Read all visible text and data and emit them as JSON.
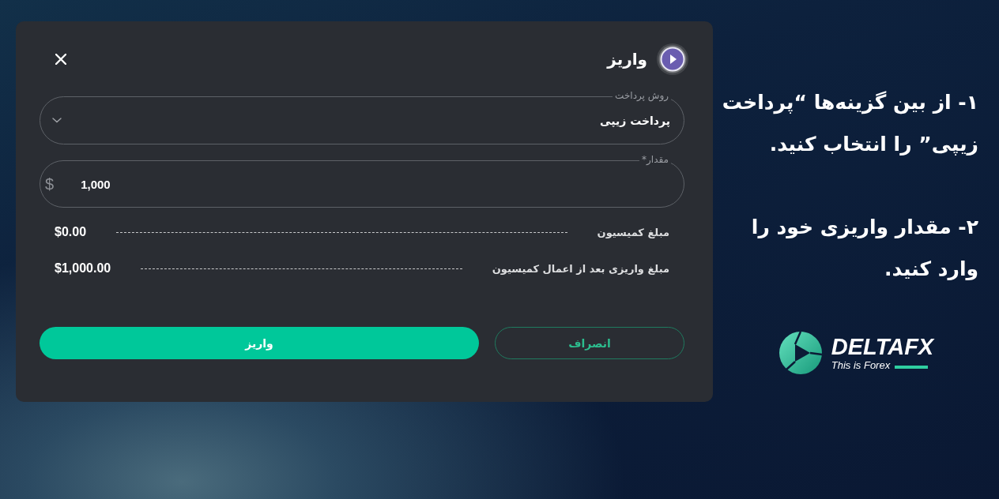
{
  "dialog": {
    "title": "واریز"
  },
  "fields": [
    {
      "kind": "select",
      "label": "روش پرداخت",
      "value": "پرداخت زیپی"
    },
    {
      "kind": "amount",
      "label": "مقدار*",
      "prefix": "$",
      "value": "1,000"
    }
  ],
  "summary": [
    {
      "label": "مبلغ کمیسیون",
      "value": "$0.00"
    },
    {
      "label": "مبلغ واریزی بعد از اعمال کمیسیون",
      "value": "$1,000.00"
    }
  ],
  "buttons": [
    {
      "kind": "secondary",
      "label": "انصراف"
    },
    {
      "kind": "primary",
      "label": "واریز"
    }
  ],
  "instructions": [
    "۱- از بین گزینه‌ها “پرداخت زیپی” را انتخاب کنید.",
    "۲- مقدار واریزی خود را وارد کنید."
  ],
  "logo": {
    "wordmark": "DELTAFX",
    "tagline": "This is Forex"
  }
}
